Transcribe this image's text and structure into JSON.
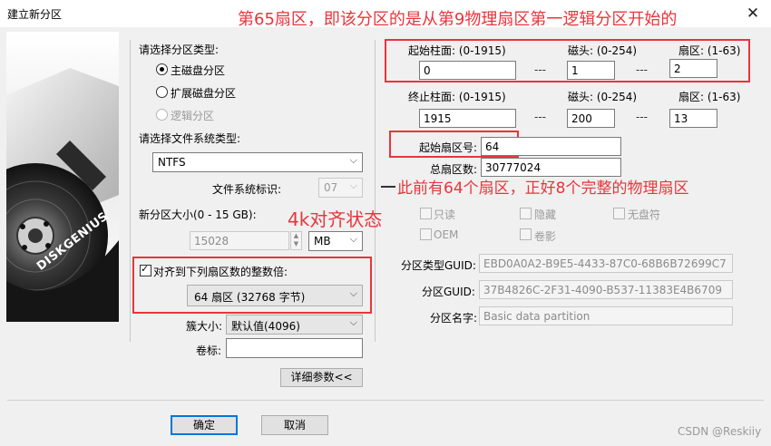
{
  "window": {
    "title": "建立新分区",
    "close_glyph": "✕"
  },
  "brand": {
    "logo_text": "DISKGENIUS"
  },
  "partition_type": {
    "label": "请选择分区类型:",
    "options": [
      {
        "label": "主磁盘分区",
        "selected": true,
        "enabled": true
      },
      {
        "label": "扩展磁盘分区",
        "selected": false,
        "enabled": true
      },
      {
        "label": "逻辑分区",
        "selected": false,
        "enabled": false
      }
    ]
  },
  "filesystem": {
    "label": "请选择文件系统类型:",
    "value": "NTFS",
    "id_label": "文件系统标识:",
    "id_value": "07"
  },
  "size": {
    "label": "新分区大小(0 - 15 GB):",
    "value": "15028",
    "unit": "MB"
  },
  "align": {
    "checked": true,
    "label": "对齐到下列扇区数的整数倍:",
    "value": "64 扇区 (32768 字节)"
  },
  "cluster": {
    "label": "簇大小:",
    "value": "默认值(4096)"
  },
  "volume": {
    "label": "卷标:",
    "value": ""
  },
  "advanced_button": "详细参数<<",
  "start": {
    "cyl_label": "起始柱面: (0-1915)",
    "head_label": "磁头: (0-254)",
    "sector_label": "扇区: (1-63)",
    "cyl": "0",
    "head": "1",
    "sector": "2"
  },
  "end": {
    "cyl_label": "终止柱面: (0-1915)",
    "head_label": "磁头: (0-254)",
    "sector_label": "扇区: (1-63)",
    "cyl": "1915",
    "head": "200",
    "sector": "13"
  },
  "separator": "---",
  "start_sector": {
    "label": "起始扇区号:",
    "value": "64"
  },
  "total_sectors": {
    "label": "总扇区数:",
    "value": "30777024"
  },
  "attributes": {
    "readonly": "只读",
    "hidden": "隐藏",
    "no_letter": "无盘符",
    "oem": "OEM",
    "shadow": "卷影"
  },
  "guid": {
    "type_label": "分区类型GUID:",
    "type_value": "EBD0A0A2-B9E5-4433-87C0-68B6B72699C7",
    "part_label": "分区GUID:",
    "part_value": "37B4826C-2F31-4090-B537-11383E4B6709",
    "name_label": "分区名字:",
    "name_value": "Basic data partition"
  },
  "buttons": {
    "ok": "确定",
    "cancel": "取消"
  },
  "annotations": {
    "top": "第65扇区，即该分区的是从第9物理扇区第一逻辑分区开始的",
    "middle": "此前有64个扇区，正好8个完整的物理扇区",
    "align_state": "4k对齐状态"
  },
  "watermark": "CSDN @Reskiiy",
  "colors": {
    "annotation": "#e8353b",
    "default_button_border": "#0078d7"
  }
}
